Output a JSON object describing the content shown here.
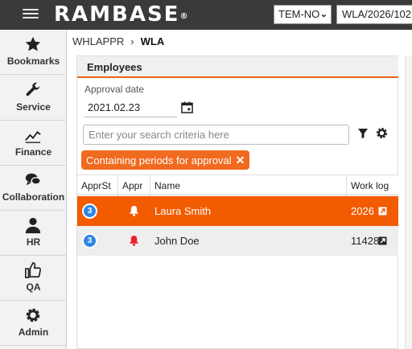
{
  "app": {
    "logo": "RAMBASE",
    "logo_mark": "®"
  },
  "topbar": {
    "company": "TEM-NO",
    "nav_value": "WLA/2026/102"
  },
  "sidebar": {
    "items": [
      {
        "label": "Bookmarks",
        "icon": "star-icon"
      },
      {
        "label": "Service",
        "icon": "wrench-icon"
      },
      {
        "label": "Finance",
        "icon": "trend-icon"
      },
      {
        "label": "Collaboration",
        "icon": "chat-icon"
      },
      {
        "label": "HR",
        "icon": "person-icon"
      },
      {
        "label": "QA",
        "icon": "thumbs-up-icon"
      },
      {
        "label": "Admin",
        "icon": "gear-icon"
      }
    ]
  },
  "breadcrumb": {
    "parent": "WHLAPPR",
    "separator": "›",
    "current": "WLA"
  },
  "panel": {
    "title": "Employees",
    "approval_date_label": "Approval date",
    "approval_date_value": "2021.02.23",
    "search_placeholder": "Enter your search criteria here",
    "filter_chip": "Containing periods for approval"
  },
  "grid": {
    "columns": [
      "ApprSt",
      "Appr",
      "Name",
      "Work log"
    ],
    "rows": [
      {
        "status": "3",
        "name": "Laura Smith",
        "work_log": "2026",
        "selected": true
      },
      {
        "status": "3",
        "name": "John Doe",
        "work_log": "11428",
        "selected": false
      }
    ]
  },
  "colors": {
    "accent": "#f25b00",
    "badge": "#2f85e6",
    "topbar": "#3a3a3a"
  }
}
